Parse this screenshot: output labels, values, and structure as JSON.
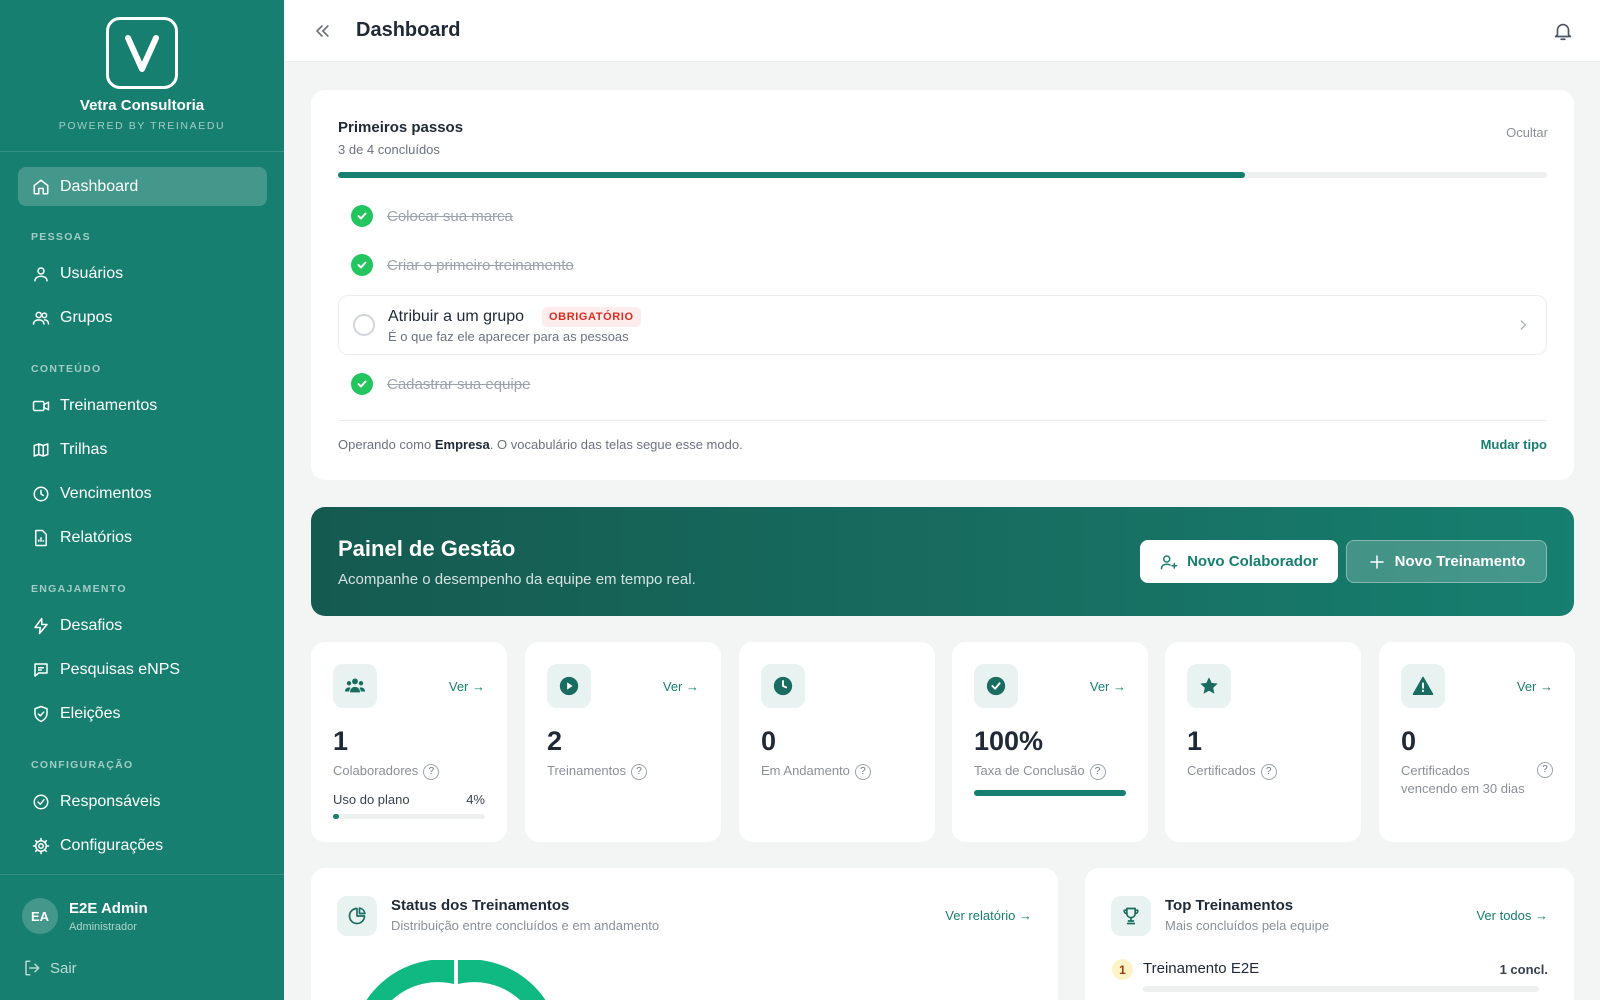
{
  "sidebar": {
    "brand_name": "Vetra Consultoria",
    "brand_sub": "POWERED BY TREINAEDU",
    "items": {
      "dashboard": "Dashboard",
      "usuarios": "Usuários",
      "grupos": "Grupos",
      "treinamentos": "Treinamentos",
      "trilhas": "Trilhas",
      "vencimentos": "Vencimentos",
      "relatorios": "Relatórios",
      "desafios": "Desafios",
      "pesquisas": "Pesquisas eNPS",
      "eleicoes": "Eleições",
      "responsaveis": "Responsáveis",
      "configuracoes": "Configurações"
    },
    "sections": {
      "pessoas": "PESSOAS",
      "conteudo": "CONTEÚDO",
      "engajamento": "ENGAJAMENTO",
      "configuracao": "CONFIGURAÇÃO"
    },
    "user": {
      "initials": "EA",
      "name": "E2E Admin",
      "role": "Administrador"
    },
    "logout": "Sair"
  },
  "header": {
    "title": "Dashboard"
  },
  "steps": {
    "title": "Primeiros passos",
    "subtitle": "3 de 4 concluídos",
    "hide": "Ocultar",
    "progress": 0.75,
    "items": [
      {
        "label": "Colocar sua marca"
      },
      {
        "label": "Criar o primeiro treinamento"
      },
      {
        "label": "Atribuir a um grupo",
        "badge": "OBRIGATÓRIO",
        "hint": "É o que faz ele aparecer para as pessoas"
      },
      {
        "label": "Cadastrar sua equipe"
      }
    ],
    "mode_prefix": "Operando como ",
    "mode_value": "Empresa",
    "mode_suffix": ". O vocabulário das telas segue esse modo.",
    "mode_link": "Mudar tipo"
  },
  "panel": {
    "title": "Painel de Gestão",
    "subtitle": "Acompanhe o desempenho da equipe em tempo real.",
    "btn_colaborador": "Novo Colaborador",
    "btn_treinamento": "Novo Treinamento"
  },
  "stats": {
    "ver": "Ver →",
    "qm": "?",
    "colaboradores": {
      "value": "1",
      "label": "Colaboradores",
      "plan_label": "Uso do plano",
      "plan_pct": "4%",
      "plan_fraction": 0.04
    },
    "treinamentos": {
      "value": "2",
      "label": "Treinamentos"
    },
    "andamento": {
      "value": "0",
      "label": "Em Andamento"
    },
    "conclusao": {
      "value": "100%",
      "label": "Taxa de Conclusão",
      "fraction": 1.0
    },
    "certificados": {
      "value": "1",
      "label": "Certificados"
    },
    "vencendo": {
      "value": "0",
      "label": "Certificados vencendo em 30 dias"
    }
  },
  "status_card": {
    "title": "Status dos Treinamentos",
    "subtitle": "Distribuição entre concluídos e em andamento",
    "link": "Ver relatório →"
  },
  "top_card": {
    "title": "Top Treinamentos",
    "subtitle": "Mais concluídos pela equipe",
    "link": "Ver todos →",
    "items": [
      {
        "rank": "1",
        "name": "Treinamento E2E",
        "count": "1 concl."
      }
    ]
  },
  "colors": {
    "brand": "#167f6f",
    "success": "#22c55e",
    "danger": "#d92d20"
  }
}
